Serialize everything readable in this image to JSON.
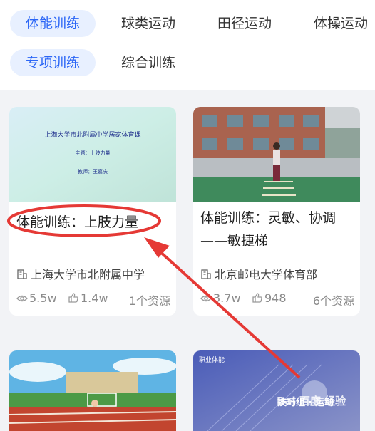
{
  "categories": {
    "row1": [
      "体能训练",
      "球类运动",
      "田径运动",
      "体操运动"
    ],
    "row2": [
      "专项训练",
      "综合训练"
    ],
    "active_row1": "体能训练",
    "active_row2": "专项训练"
  },
  "cards": [
    {
      "thumb_lines": [
        "上海大学市北附属中学居家体育课",
        "主题：上肢力量",
        "教师：王嘉庆"
      ],
      "title": "体能训练：上肢力量",
      "org": "上海大学市北附属中学",
      "views": "5.5w",
      "likes": "1.4w",
      "resources": "1个资源"
    },
    {
      "title": "体能训练：灵敏、协调——敏捷梯",
      "org": "北京邮电大学体育部",
      "views": "3.7w",
      "likes": "948",
      "resources": "6个资源"
    },
    {},
    {
      "thumb_label": "职业体能",
      "thumb_overlay": "技巧组 · 运动"
    }
  ],
  "watermark": "Bai 百度 经验",
  "colors": {
    "accent": "#2b66f6",
    "chip_active_bg": "#e8f0ff",
    "annotation": "#e53935"
  }
}
